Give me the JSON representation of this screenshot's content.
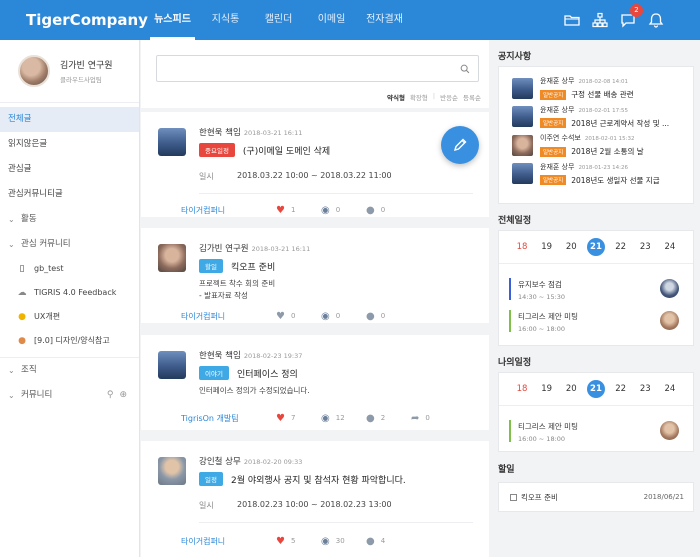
{
  "header": {
    "brand": "TigerCompany",
    "nav": [
      "뉴스피드",
      "지식통",
      "캘린더",
      "이메일",
      "전자결재"
    ],
    "active_nav": "뉴스피드",
    "notification_count": "2"
  },
  "sidebar": {
    "profile": {
      "name": "김가빈 연구원",
      "dept": "클라우드사업팀"
    },
    "items": [
      "전체글",
      "읽지않은글",
      "관심글",
      "관심커뮤니티글"
    ],
    "group_activity": "활동",
    "group_interest": "관심 커뮤니티",
    "communities": [
      {
        "label": "gb_test",
        "icon": "phone-icon"
      },
      {
        "label": "TIGRIS 4.0 Feedback",
        "icon": "cloud-icon"
      },
      {
        "label": "UX개편",
        "icon": "sun-icon"
      },
      {
        "label": "[9.0] 디자인/양식참고",
        "icon": "badge-icon"
      }
    ],
    "group_org": "조직",
    "group_community": "커뮤니티"
  },
  "feed": {
    "search_placeholder": "",
    "sort": {
      "a": "약식형",
      "b": "확장형",
      "c": "반응순",
      "d": "등록순"
    },
    "posts": [
      {
        "author": "한현욱 책임",
        "date": "2018-03-21 16:11",
        "tag": "중요일정",
        "title": "(구)이메일 도메인 삭제",
        "schedule_label": "일시",
        "schedule": "2018.03.22 10:00 ~ 2018.03.22 11:00",
        "community": "타이거컴퍼니",
        "likes": "1",
        "views": "0",
        "comments": "0"
      },
      {
        "author": "김가빈 연구원",
        "date": "2018-03-21 16:11",
        "tag": "할일",
        "title": "킥오프 준비",
        "text1": "프로젝트 착수 회의 준비",
        "text2": "- 발표자료 작성",
        "community": "타이거컴퍼니",
        "likes": "0",
        "views": "0",
        "comments": "0"
      },
      {
        "author": "한현욱 책임",
        "date": "2018-02-23 19:37",
        "tag": "이야기",
        "title": "인터페이스 정의",
        "text1": "인터페이스 정의가 수정되었습니다.",
        "community": "TigrisOn 개발팀",
        "likes": "7",
        "views": "12",
        "comments": "2",
        "shares": "0"
      },
      {
        "author": "강인철 상무",
        "date": "2018-02-20 09:33",
        "tag": "일정",
        "title": "2월 야외행사 공지 및 참석자 현황 파악합니다.",
        "schedule_label": "일시",
        "schedule": "2018.02.23 10:00 ~ 2018.02.23 13:00",
        "community": "타이거컴퍼니",
        "likes": "5",
        "views": "30",
        "comments": "4"
      }
    ]
  },
  "notices": {
    "title": "공지사항",
    "items": [
      {
        "name": "윤재훈 상무",
        "date": "2018-02-08 14:01",
        "tag": "일반공지",
        "title": "구정 선물 배송 관련"
      },
      {
        "name": "윤재훈 상무",
        "date": "2018-02-01 17:55",
        "tag": "일반공지",
        "title": "2018년 근로계약서 작성 및 ..."
      },
      {
        "name": "이주연 수석보",
        "date": "2018-02-01 15:32",
        "tag": "일반공지",
        "title": "2018년 2월 소통의 날"
      },
      {
        "name": "윤재훈 상무",
        "date": "2018-01-23 14:26",
        "tag": "일반공지",
        "title": "2018년도 생일자 선물 지급"
      }
    ]
  },
  "all_schedule": {
    "title": "전체일정",
    "days": [
      "18",
      "19",
      "20",
      "21",
      "22",
      "23",
      "24"
    ],
    "events": [
      {
        "title": "유지보수 점검",
        "time": "14:30 ~ 15:30",
        "color": "#3a5fd8"
      },
      {
        "title": "티그리스 제안 미팅",
        "time": "16:00 ~ 18:00",
        "color": "#7ec04a"
      }
    ]
  },
  "my_schedule": {
    "title": "나의일정",
    "days": [
      "18",
      "19",
      "20",
      "21",
      "22",
      "23",
      "24"
    ],
    "events": [
      {
        "title": "티그리스 제안 미팅",
        "time": "16:00 ~ 18:00",
        "color": "#7ec04a"
      }
    ]
  },
  "todo": {
    "title": "할일",
    "items": [
      {
        "label": "킥오프 준비",
        "date": "2018/06/21"
      }
    ]
  }
}
